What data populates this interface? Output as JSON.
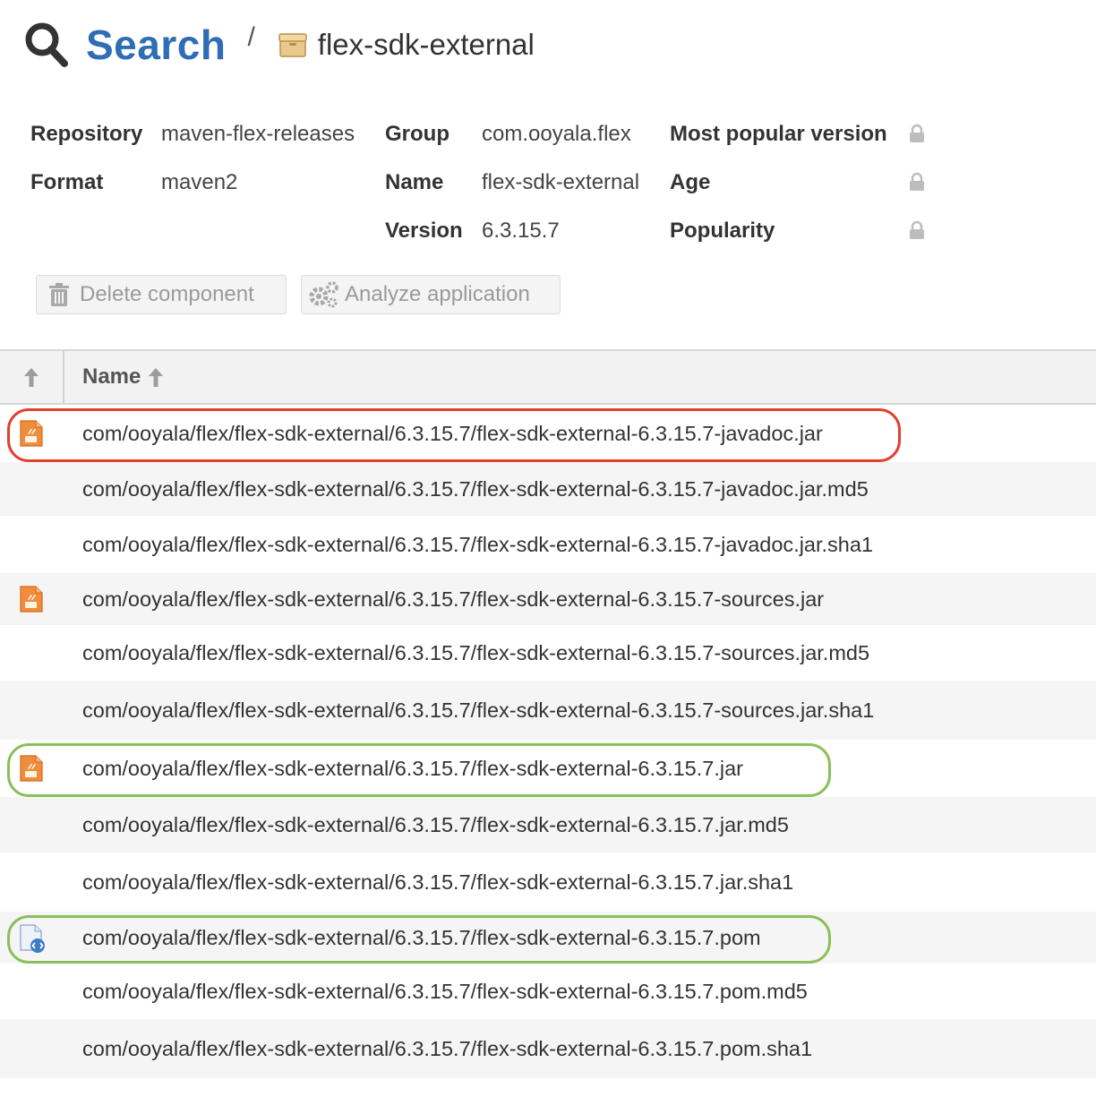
{
  "breadcrumb": {
    "search_label": "Search",
    "separator": "/",
    "current": "flex-sdk-external"
  },
  "attributes": {
    "repository": {
      "label": "Repository",
      "value": "maven-flex-releases"
    },
    "format": {
      "label": "Format",
      "value": "maven2"
    },
    "group": {
      "label": "Group",
      "value": "com.ooyala.flex"
    },
    "name": {
      "label": "Name",
      "value": "flex-sdk-external"
    },
    "version": {
      "label": "Version",
      "value": "6.3.15.7"
    },
    "most_popular_version": {
      "label": "Most popular version"
    },
    "age": {
      "label": "Age"
    },
    "popularity": {
      "label": "Popularity"
    }
  },
  "toolbar": {
    "delete_label": "Delete component",
    "analyze_label": "Analyze application"
  },
  "table": {
    "name_header": "Name",
    "rows": [
      {
        "path": "com/ooyala/flex/flex-sdk-external/6.3.15.7/flex-sdk-external-6.3.15.7-javadoc.jar",
        "icon": "jar-file-icon",
        "highlight": "red"
      },
      {
        "path": "com/ooyala/flex/flex-sdk-external/6.3.15.7/flex-sdk-external-6.3.15.7-javadoc.jar.md5"
      },
      {
        "path": "com/ooyala/flex/flex-sdk-external/6.3.15.7/flex-sdk-external-6.3.15.7-javadoc.jar.sha1"
      },
      {
        "path": "com/ooyala/flex/flex-sdk-external/6.3.15.7/flex-sdk-external-6.3.15.7-sources.jar",
        "icon": "jar-file-icon"
      },
      {
        "path": "com/ooyala/flex/flex-sdk-external/6.3.15.7/flex-sdk-external-6.3.15.7-sources.jar.md5"
      },
      {
        "path": "com/ooyala/flex/flex-sdk-external/6.3.15.7/flex-sdk-external-6.3.15.7-sources.jar.sha1"
      },
      {
        "path": "com/ooyala/flex/flex-sdk-external/6.3.15.7/flex-sdk-external-6.3.15.7.jar",
        "icon": "jar-file-icon",
        "highlight": "green"
      },
      {
        "path": "com/ooyala/flex/flex-sdk-external/6.3.15.7/flex-sdk-external-6.3.15.7.jar.md5"
      },
      {
        "path": "com/ooyala/flex/flex-sdk-external/6.3.15.7/flex-sdk-external-6.3.15.7.jar.sha1"
      },
      {
        "path": "com/ooyala/flex/flex-sdk-external/6.3.15.7/flex-sdk-external-6.3.15.7.pom",
        "icon": "xml-file-icon",
        "highlight": "green"
      },
      {
        "path": "com/ooyala/flex/flex-sdk-external/6.3.15.7/flex-sdk-external-6.3.15.7.pom.md5"
      },
      {
        "path": "com/ooyala/flex/flex-sdk-external/6.3.15.7/flex-sdk-external-6.3.15.7.pom.sha1"
      }
    ]
  },
  "colors": {
    "link": "#2f6db5",
    "highlight_red": "#e2402f",
    "highlight_green": "#8cbf5a"
  }
}
